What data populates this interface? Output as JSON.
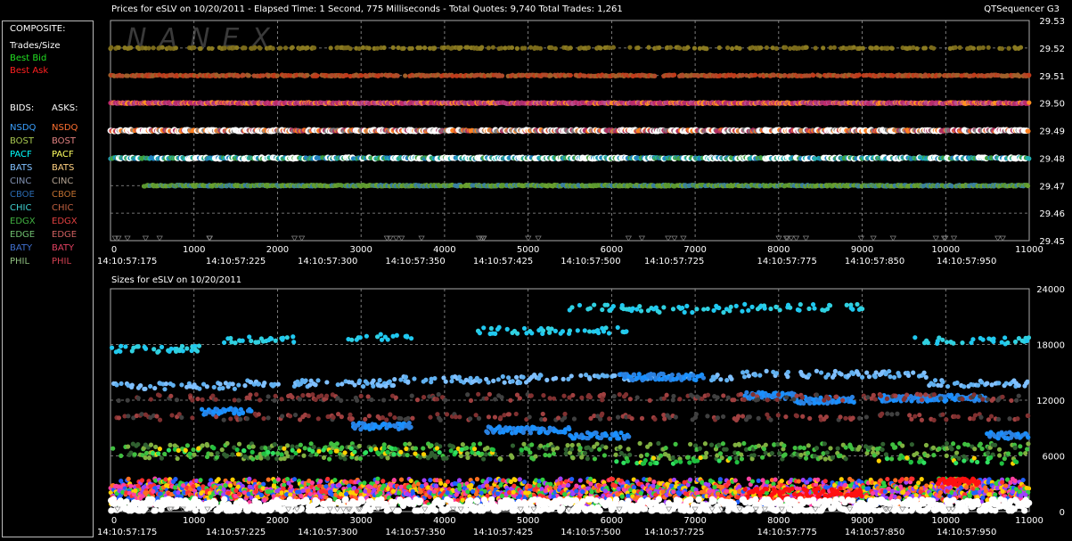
{
  "header": {
    "title": "Prices for  eSLV  on  10/20/2011   -  Elapsed Time: 1 Second, 775 Milliseconds   -  Total Quotes: 9,740   Total Trades: 1,261",
    "app": "QTSequencer G3",
    "sizes_title": "Sizes for  eSLV  on  10/20/2011",
    "watermark": "NANEX"
  },
  "legend": {
    "composite_label": "COMPOSITE:",
    "composite_items": [
      {
        "label": "Trades/Size",
        "color": "#ffffff"
      },
      {
        "label": "Best Bid",
        "color": "#22e022"
      },
      {
        "label": "Best Ask",
        "color": "#ff2020"
      }
    ],
    "bids_label": "BIDS:",
    "asks_label": "ASKS:",
    "bids": [
      {
        "label": "NSDQ",
        "color": "#3aa0ff"
      },
      {
        "label": "BOST",
        "color": "#a8c850"
      },
      {
        "label": "PACF",
        "color": "#00ffff"
      },
      {
        "label": "BATS",
        "color": "#80c0ff"
      },
      {
        "label": "CINC",
        "color": "#8090b0"
      },
      {
        "label": "CBOE",
        "color": "#2a6ab0"
      },
      {
        "label": "CHIC",
        "color": "#40d0d0"
      },
      {
        "label": "EDGX",
        "color": "#40b040"
      },
      {
        "label": "EDGE",
        "color": "#70c070"
      },
      {
        "label": "BATY",
        "color": "#4070d0"
      },
      {
        "label": "PHIL",
        "color": "#90c080"
      }
    ],
    "asks": [
      {
        "label": "NSDQ",
        "color": "#ff7030"
      },
      {
        "label": "BOST",
        "color": "#e08080"
      },
      {
        "label": "PACF",
        "color": "#ffff60"
      },
      {
        "label": "BATS",
        "color": "#ffd080"
      },
      {
        "label": "CINC",
        "color": "#b0a090"
      },
      {
        "label": "CBOE",
        "color": "#c07030"
      },
      {
        "label": "CHIC",
        "color": "#c06040"
      },
      {
        "label": "EDGX",
        "color": "#e04040"
      },
      {
        "label": "EDGE",
        "color": "#d06060"
      },
      {
        "label": "BATY",
        "color": "#e04060"
      },
      {
        "label": "PHIL",
        "color": "#d04050"
      }
    ]
  },
  "chart_data": [
    {
      "type": "scatter",
      "title": "Prices for  eSLV  on  10/20/2011",
      "xlim": [
        0,
        11000
      ],
      "ylim": [
        29.45,
        29.53
      ],
      "x_ticks": [
        0,
        1000,
        2000,
        3000,
        4000,
        5000,
        6000,
        7000,
        8000,
        9000,
        10000,
        11000
      ],
      "y_ticks": [
        "29.45",
        "29.46",
        "29.47",
        "29.48",
        "29.49",
        "29.50",
        "29.51",
        "29.52",
        "29.53"
      ],
      "time_labels": [
        {
          "x": 200,
          "label": "14:10:57:175"
        },
        {
          "x": 1500,
          "label": "14:10:57:225"
        },
        {
          "x": 2600,
          "label": "14:10:57:300"
        },
        {
          "x": 3650,
          "label": "14:10:57:350"
        },
        {
          "x": 4700,
          "label": "14:10:57:425"
        },
        {
          "x": 5750,
          "label": "14:10:57:500"
        },
        {
          "x": 6750,
          "label": "14:10:57:725"
        },
        {
          "x": 8100,
          "label": "14:10:57:775"
        },
        {
          "x": 9150,
          "label": "14:10:57:850"
        },
        {
          "x": 10250,
          "label": "14:10:57:950"
        }
      ],
      "grid": true,
      "series": [
        {
          "price": 29.52,
          "x_range": [
            0,
            11000
          ],
          "colors": [
            "#7a6a1a",
            "#8a7a20"
          ],
          "density": 0.22
        },
        {
          "price": 29.51,
          "x_range": [
            0,
            11000
          ],
          "colors": [
            "#c03a1a",
            "#b04a2a",
            "#a0602a"
          ],
          "density": 0.55
        },
        {
          "price": 29.5,
          "x_range": [
            0,
            11000
          ],
          "colors": [
            "#c02a6a",
            "#a83070",
            "#b85090",
            "#ff9020"
          ],
          "density": 0.95
        },
        {
          "price": 29.49,
          "x_range": [
            0,
            11000
          ],
          "colors": [
            "#ffffff",
            "#b03060",
            "#ff8020",
            "#808080"
          ],
          "density": 0.95
        },
        {
          "price": 29.48,
          "x_range": [
            0,
            11000
          ],
          "colors": [
            "#ffffff",
            "#20b0b0",
            "#40a040",
            "#2080c0"
          ],
          "density": 0.85
        },
        {
          "price": 29.47,
          "x_range": [
            400,
            11000
          ],
          "colors": [
            "#6aa030",
            "#5a9830",
            "#3a80a0"
          ],
          "density": 0.8
        }
      ]
    },
    {
      "type": "scatter",
      "title": "Sizes for  eSLV  on  10/20/2011",
      "xlim": [
        0,
        11000
      ],
      "ylim": [
        0,
        24000
      ],
      "x_ticks": [
        0,
        1000,
        2000,
        3000,
        4000,
        5000,
        6000,
        7000,
        8000,
        9000,
        10000,
        11000
      ],
      "y_ticks": [
        "0",
        "6000",
        "12000",
        "18000",
        "24000"
      ],
      "time_labels": [
        {
          "x": 200,
          "label": "14:10:57:175"
        },
        {
          "x": 1500,
          "label": "14:10:57:225"
        },
        {
          "x": 2600,
          "label": "14:10:57:300"
        },
        {
          "x": 3650,
          "label": "14:10:57:350"
        },
        {
          "x": 4700,
          "label": "14:10:57:425"
        },
        {
          "x": 5750,
          "label": "14:10:57:500"
        },
        {
          "x": 6750,
          "label": "14:10:57:725"
        },
        {
          "x": 8100,
          "label": "14:10:57:775"
        },
        {
          "x": 9150,
          "label": "14:10:57:850"
        },
        {
          "x": 10250,
          "label": "14:10:57:950"
        }
      ],
      "grid": true,
      "series": [
        {
          "segments": [
            [
              0,
              1100,
              17500
            ],
            [
              1300,
              2200,
              18500
            ],
            [
              2800,
              3600,
              18800
            ],
            [
              4400,
              6200,
              19500
            ],
            [
              5500,
              6200,
              22000
            ],
            [
              6200,
              7600,
              21800
            ],
            [
              7600,
              9000,
              22000
            ],
            [
              9600,
              11000,
              18400
            ]
          ],
          "colors": [
            "#30d0e0",
            "#20c8f0"
          ],
          "density": 0.35
        },
        {
          "segments": [
            [
              0,
              1600,
              13500
            ],
            [
              1600,
              3400,
              13800
            ],
            [
              3400,
              5000,
              14200
            ],
            [
              5000,
              7500,
              14500
            ],
            [
              7500,
              9800,
              14800
            ],
            [
              9800,
              11000,
              13800
            ]
          ],
          "colors": [
            "#80c0ff",
            "#60b0f0"
          ],
          "density": 0.4
        },
        {
          "segments": [
            [
              1100,
              1700,
              10800
            ],
            [
              2900,
              3600,
              9200
            ],
            [
              4500,
              5500,
              8800
            ],
            [
              5500,
              6200,
              8200
            ],
            [
              6100,
              7100,
              14500
            ],
            [
              7600,
              8200,
              12500
            ],
            [
              8200,
              8900,
              12000
            ],
            [
              9200,
              10500,
              12200
            ],
            [
              10500,
              11000,
              8200
            ]
          ],
          "colors": [
            "#1a90ff",
            "#2a80e0"
          ],
          "density": 0.9
        },
        {
          "segments": [
            [
              0,
              11000,
              10200
            ],
            [
              0,
              11000,
              12300
            ]
          ],
          "colors": [
            "#a04040",
            "#404040",
            "#803030"
          ],
          "density": 0.25
        },
        {
          "segments": [
            [
              0,
              11000,
              6000
            ],
            [
              0,
              11000,
              7000
            ]
          ],
          "colors": [
            "#40c040",
            "#80b040",
            "#306030"
          ],
          "density": 0.3
        },
        {
          "segments": [
            [
              500,
              5000,
              6500
            ],
            [
              6000,
              7500,
              5500
            ],
            [
              9200,
              11000,
              5500
            ]
          ],
          "colors": [
            "#30e060",
            "#20c040",
            "#ffd000"
          ],
          "density": 0.2
        },
        {
          "segments": [
            [
              0,
              11000,
              2500
            ],
            [
              0,
              11000,
              1800
            ],
            [
              0,
              11000,
              1200
            ]
          ],
          "colors": [
            "#ff3030",
            "#ff7020",
            "#ffd000",
            "#30d040",
            "#ff40a0",
            "#2060ff",
            "#a040ff"
          ],
          "density": 0.95
        },
        {
          "segments": [
            [
              7600,
              9000,
              1500
            ],
            [
              9900,
              10400,
              3200
            ]
          ],
          "colors": [
            "#ff1010"
          ],
          "density": 1.0
        },
        {
          "segments": [
            [
              0,
              11000,
              300
            ]
          ],
          "colors": [
            "#ffffff"
          ],
          "density": 1.0
        }
      ]
    }
  ]
}
